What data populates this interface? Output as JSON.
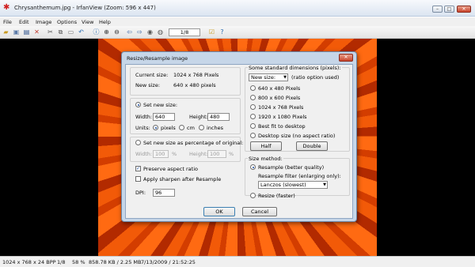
{
  "window": {
    "title": "Chrysanthemum.jpg - IrfanView (Zoom: 596 x 447)",
    "min": "–",
    "max": "□",
    "close": "✕"
  },
  "menu": [
    "File",
    "Edit",
    "Image",
    "Options",
    "View",
    "Help"
  ],
  "toolbar": {
    "page_counter": "1/8"
  },
  "status": {
    "dims": "1024 x 768 x 24 BPP",
    "page": "1/8",
    "zoom": "58 %",
    "size": "858.78 KB / 2.25 MB",
    "datetime": "7/13/2009 / 21:52:25"
  },
  "dialog": {
    "title": "Resize/Resample image",
    "close": "✕",
    "current_size_label": "Current size:",
    "current_size_value": "1024  x  768  Pixels",
    "new_size_label": "New size:",
    "new_size_value": "640  x  480  pixels",
    "set_new_size": "Set new size:",
    "width_label": "Width:",
    "width_value": "640",
    "height_label": "Height:",
    "height_value": "480",
    "units_label": "Units:",
    "unit_pixels": "pixels",
    "unit_cm": "cm",
    "unit_inches": "inches",
    "percent_label": "Set new size as percentage of original:",
    "pct_width_label": "Width:",
    "pct_width_value": "100",
    "pct_height_label": "Height:",
    "pct_height_value": "100",
    "pct_sym": "%",
    "preserve_aspect": "Preserve aspect ratio",
    "apply_sharpen": "Apply sharpen after Resample",
    "dpi_label": "DPI:",
    "dpi_value": "96",
    "standard_header": "Some standard dimensions (pixels):",
    "new_size_select": "New size:",
    "ratio_note": "(ratio option used)",
    "dims": [
      "640 x 480 Pixels",
      "800 x 600 Pixels",
      "1024 x 768 Pixels",
      "1920 x 1080 Pixels",
      "Best fit to desktop",
      "Desktop size (no aspect ratio)"
    ],
    "half": "Half",
    "double": "Double",
    "size_method": "Size method:",
    "resample": "Resample (better quality)",
    "resample_filter": "Resample filter (enlarging only):",
    "filter_value": "Lanczos (slowest)",
    "resize": "Resize (faster)",
    "ok": "OK",
    "cancel": "Cancel"
  }
}
